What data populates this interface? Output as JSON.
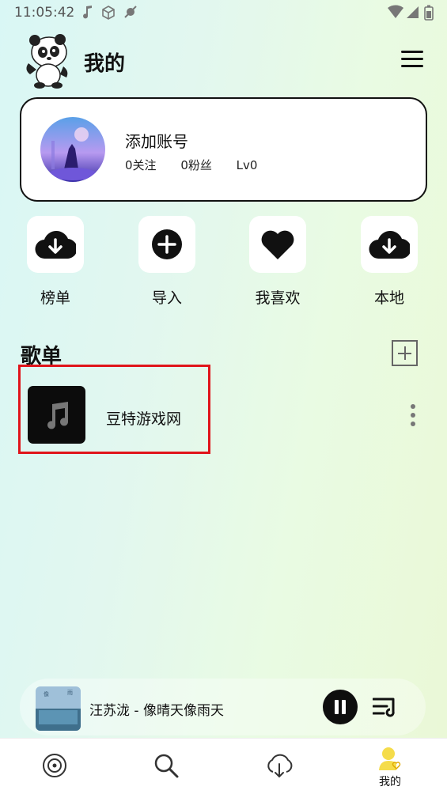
{
  "status_bar": {
    "time": "11:05:42"
  },
  "header": {
    "title": "我的"
  },
  "profile": {
    "account_name": "添加账号",
    "follows": "0关注",
    "fans": "0粉丝",
    "level": "Lv0"
  },
  "quick_actions": [
    {
      "label": "榜单",
      "icon": "cloud-download-icon"
    },
    {
      "label": "导入",
      "icon": "plus-circle-icon"
    },
    {
      "label": "我喜欢",
      "icon": "heart-icon"
    },
    {
      "label": "本地",
      "icon": "cloud-download-icon"
    }
  ],
  "playlists": {
    "section_title": "歌单",
    "items": [
      {
        "name": "豆特游戏网",
        "icon": "music-note-icon"
      }
    ]
  },
  "now_playing": {
    "title": "汪苏泷 - 像晴天像雨天"
  },
  "bottom_nav": {
    "mine_label": "我的"
  },
  "colors": {
    "highlight": "#e0141a",
    "accent_yellow": "#f5dc4a"
  }
}
